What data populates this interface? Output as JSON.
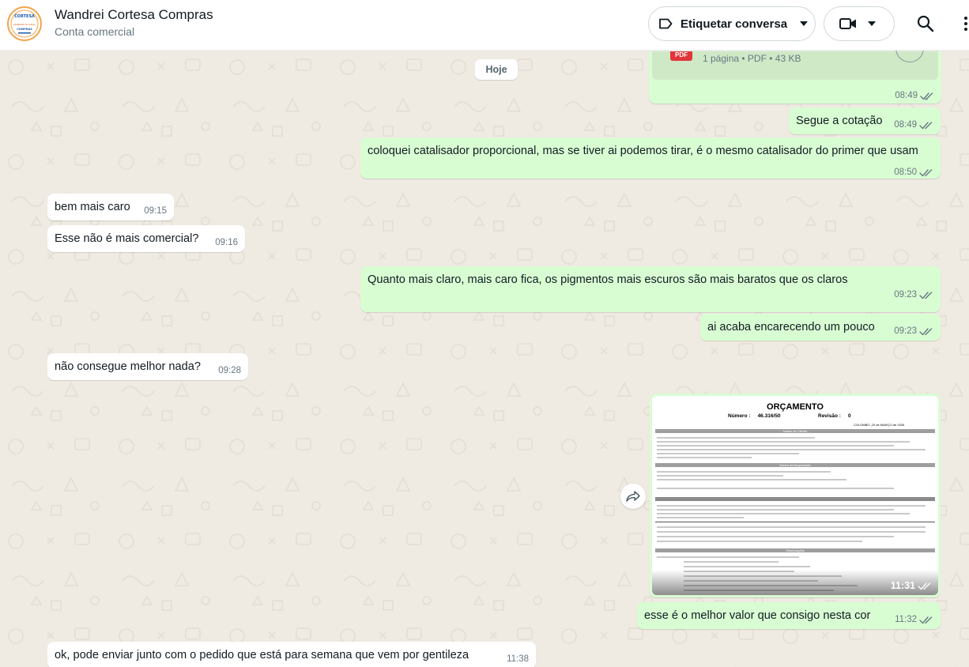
{
  "header": {
    "contact_name": "Wandrei Cortesa Compras",
    "contact_subtitle": "Conta comercial",
    "avatar_lines": [
      "CORTESA",
      "MANDRE DA SILVA",
      "COMPRAS"
    ],
    "label_button": "Etiquetar conversa"
  },
  "date_divider": "Hoje",
  "document": {
    "icon_label": "PDF",
    "info": "1 página • PDF • 43 KB",
    "time": "08:49"
  },
  "messages": [
    {
      "id": "m1",
      "dir": "out",
      "text": "Segue a cotação",
      "time": "08:49"
    },
    {
      "id": "m2",
      "dir": "out",
      "text": "coloquei catalisador proporcional, mas se tiver ai podemos tirar, é o mesmo catalisador do primer que usam",
      "time": "08:50"
    },
    {
      "id": "m3",
      "dir": "in",
      "text": "bem mais caro",
      "time": "09:15"
    },
    {
      "id": "m4",
      "dir": "in",
      "text": "Esse não é mais comercial?",
      "time": "09:16"
    },
    {
      "id": "m5",
      "dir": "out",
      "text": "Quanto mais claro, mais caro fica, os pigmentos mais escuros são mais baratos que os claros",
      "time": "09:23"
    },
    {
      "id": "m6",
      "dir": "out",
      "text": "ai acaba encarecendo um pouco",
      "time": "09:23"
    },
    {
      "id": "m7",
      "dir": "in",
      "text": "não consegue melhor nada?",
      "time": "09:28"
    },
    {
      "id": "m8",
      "dir": "out",
      "text": "esse é o melhor valor que consigo nesta cor",
      "time": "11:32"
    },
    {
      "id": "m9",
      "dir": "in",
      "text": "ok, pode enviar junto com o pedido que está para semana que vem por gentileza",
      "time": "11:38"
    }
  ],
  "image_message": {
    "time": "11:31",
    "doc_title": "ORÇAMENTO",
    "number_label": "Número :",
    "number_value": "46.316/50",
    "revision_label": "Revisão :",
    "revision_value": "0",
    "date_text": "COLOMBO ,20 de MARÇO de 2025",
    "sections": [
      "Dados do Cliente",
      "Dados da Negociação",
      "Observações"
    ]
  },
  "colors": {
    "outgoing": "#d9fdd3",
    "incoming": "#ffffff",
    "background": "#efeae2",
    "read_ticks": "#53bdeb",
    "delivered_ticks": "#667781"
  },
  "icons": [
    "label-icon",
    "chevron-down-icon",
    "video-icon",
    "search-icon",
    "menu-icon",
    "pdf-icon",
    "download-icon",
    "forward-icon",
    "double-check-icon"
  ]
}
